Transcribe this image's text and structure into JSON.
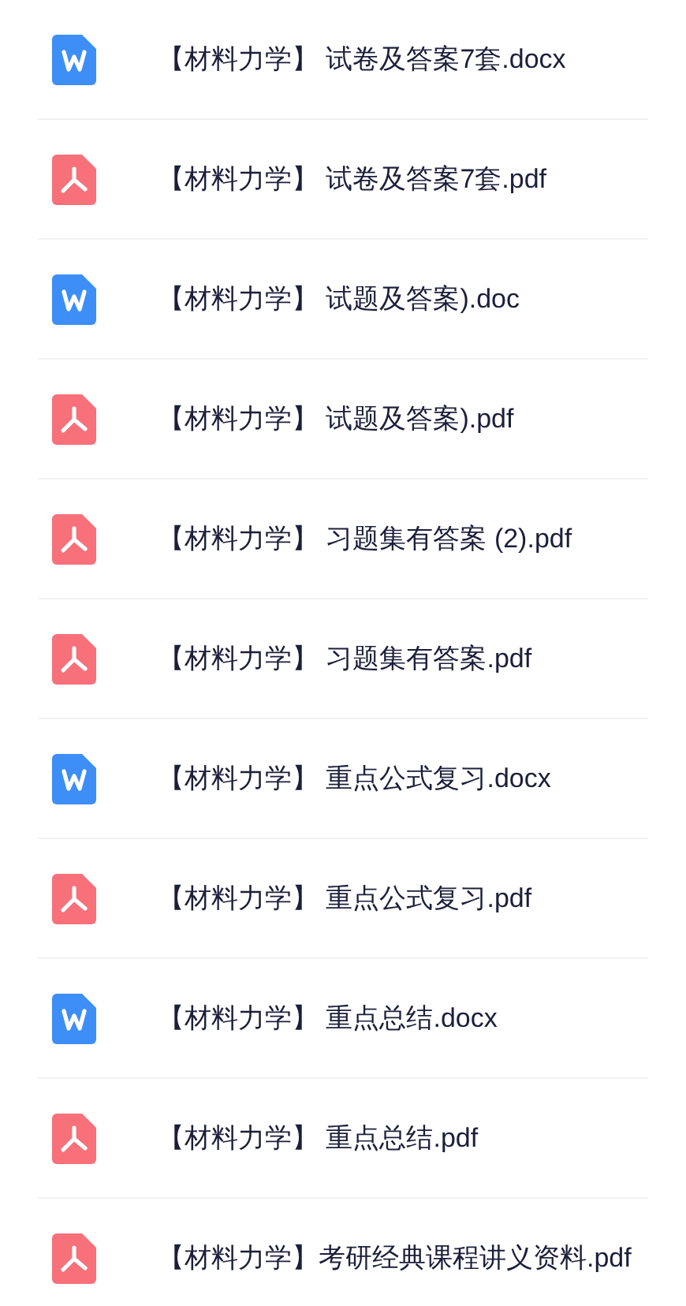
{
  "files": [
    {
      "kind": "word",
      "name": "【材料力学】 试卷及答案7套.docx"
    },
    {
      "kind": "pdf",
      "name": "【材料力学】 试卷及答案7套.pdf"
    },
    {
      "kind": "word",
      "name": "【材料力学】 试题及答案).doc"
    },
    {
      "kind": "pdf",
      "name": "【材料力学】 试题及答案).pdf"
    },
    {
      "kind": "pdf",
      "name": "【材料力学】 习题集有答案 (2).pdf"
    },
    {
      "kind": "pdf",
      "name": "【材料力学】 习题集有答案.pdf"
    },
    {
      "kind": "word",
      "name": "【材料力学】 重点公式复习.docx"
    },
    {
      "kind": "pdf",
      "name": "【材料力学】 重点公式复习.pdf"
    },
    {
      "kind": "word",
      "name": "【材料力学】 重点总结.docx"
    },
    {
      "kind": "pdf",
      "name": "【材料力学】 重点总结.pdf"
    },
    {
      "kind": "pdf",
      "name": "【材料力学】考研经典课程讲义资料.pdf"
    }
  ]
}
